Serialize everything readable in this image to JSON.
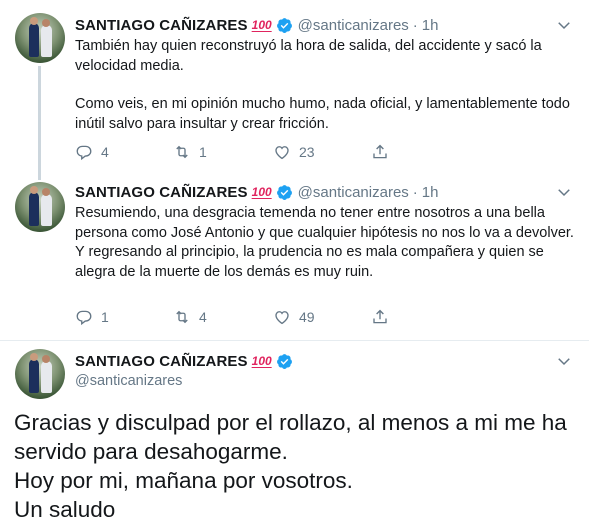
{
  "account": {
    "name": "SANTIAGO CAÑIZARES",
    "badge_emoji": "100",
    "handle": "@santicanizares"
  },
  "tweets": [
    {
      "time": "1h",
      "paragraphs": [
        "También hay quien reconstruyó la hora de salida, del accidente y sacó la velocidad media.",
        "Como veis, en mi opinión mucho humo, nada oficial, y lamentablemente todo inútil salvo para insultar y crear fricción."
      ],
      "replies": "4",
      "retweets": "1",
      "likes": "23"
    },
    {
      "time": "1h",
      "paragraphs": [
        "Resumiendo, una desgracia temenda no tener entre nosotros a una bella persona como José Antonio y que cualquier hipótesis no nos lo va a devolver.",
        "Y regresando al principio, la prudencia no es mala compañera y quien se alegra de la muerte de los demás es muy ruin."
      ],
      "replies": "1",
      "retweets": "4",
      "likes": "49"
    }
  ],
  "main_tweet": {
    "lines": [
      "Gracias y disculpad por el rollazo, al menos a mi me ha servido para desahogarme.",
      "Hoy por mi, mañana por vosotros.",
      "Un saludo"
    ]
  },
  "colors": {
    "verified": "#1da1f2",
    "muted": "#657786",
    "text": "#14171a",
    "emoji_red": "#e0245e"
  },
  "icons": [
    "reply-icon",
    "retweet-icon",
    "like-icon",
    "share-icon",
    "verified-icon",
    "chevron-down-icon"
  ]
}
